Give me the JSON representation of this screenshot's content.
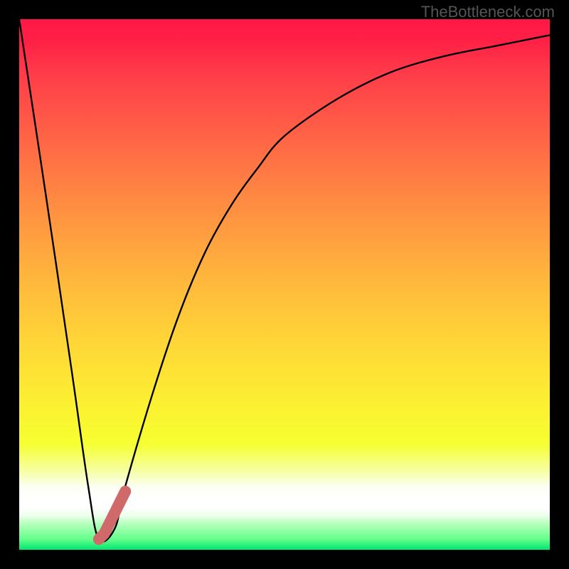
{
  "watermark": "TheBottleneck.com",
  "chart_data": {
    "type": "line",
    "title": "",
    "xlabel": "",
    "ylabel": "",
    "xlim": [
      0,
      100
    ],
    "ylim": [
      0,
      100
    ],
    "series": [
      {
        "name": "bottleneck-curve",
        "x": [
          0,
          5,
          10,
          13,
          15,
          18,
          20,
          25,
          30,
          35,
          40,
          45,
          50,
          60,
          70,
          80,
          90,
          100
        ],
        "values": [
          100,
          67,
          33,
          12,
          2,
          4,
          12,
          29,
          44,
          56,
          65,
          72,
          78,
          85,
          90,
          93,
          95,
          97
        ]
      },
      {
        "name": "highlighted-range",
        "x": [
          15,
          16,
          17,
          18,
          19,
          20
        ],
        "values": [
          2,
          3,
          5,
          7,
          9,
          11
        ]
      }
    ],
    "colors": {
      "curve": "#000000",
      "highlight": "#d06a6a"
    }
  }
}
